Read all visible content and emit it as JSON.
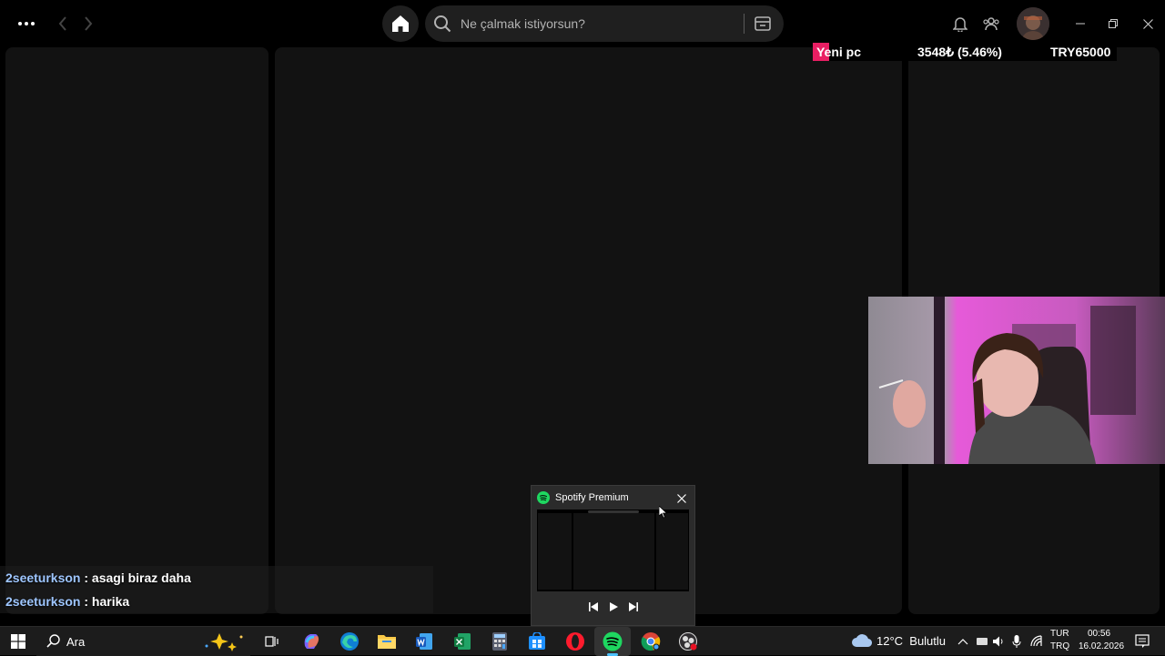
{
  "topbar": {
    "search_placeholder": "Ne çalmak istiyorsun?"
  },
  "donation": {
    "label": "Yeni pc",
    "amount": "3548₺ (5.46%)",
    "goal": "TRY65000",
    "progress_fraction": 0.0546,
    "accent_color": "#e91e63"
  },
  "chat": [
    {
      "user": "2seeturkson",
      "message": " : asagi biraz daha"
    },
    {
      "user": "2seeturkson",
      "message": " : harika"
    }
  ],
  "thumbnail": {
    "title": "Spotify Premium"
  },
  "taskbar": {
    "search_label": "Ara",
    "weather": "12°C  Bulutlu",
    "lang_top": "TUR",
    "lang_bottom": "TRQ",
    "time": "00:56",
    "date": "16.02.2026",
    "apps": [
      "windows-start-icon",
      "search-icon",
      "copilot-sparkle-icon",
      "task-view-icon",
      "copilot-icon",
      "edge-icon",
      "file-explorer-icon",
      "word-icon",
      "excel-icon",
      "calculator-icon",
      "store-icon",
      "opera-icon",
      "spotify-icon",
      "chrome-icon",
      "obs-icon"
    ]
  },
  "colors": {
    "spotify_green": "#1ed760",
    "panel": "#121212",
    "taskbar": "#1c1c1c"
  }
}
